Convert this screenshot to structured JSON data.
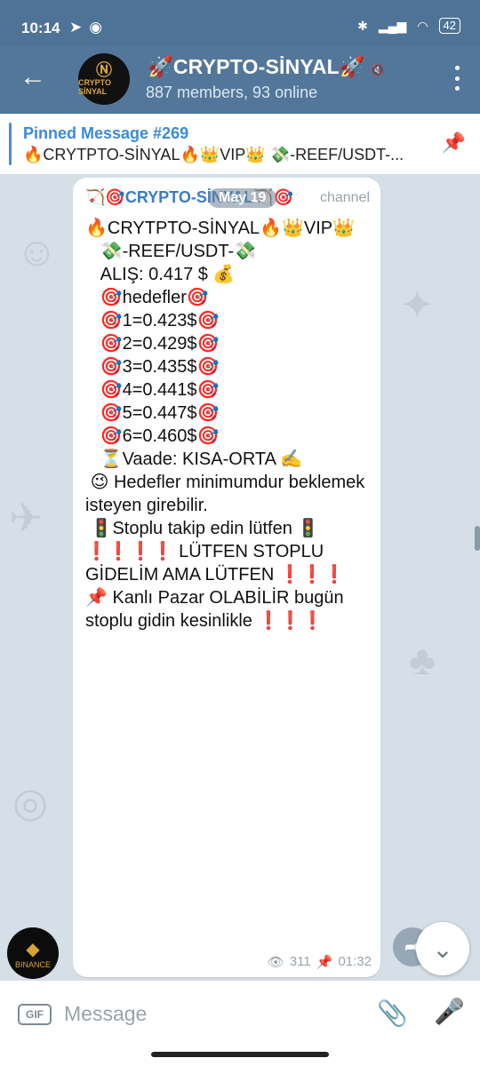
{
  "status": {
    "time": "10:14",
    "battery": "42"
  },
  "header": {
    "title": "🚀CRYPTO-SİNYAL🚀",
    "subtitle": "887 members, 93 online",
    "avatar_text": "CRYPTO SİNYAL"
  },
  "pinned": {
    "title": "Pinned Message #269",
    "text": "🔥CRYTPTO-SİNYAL🔥👑VIP👑    💸-REEF/USDT-..."
  },
  "message": {
    "sender": "🏹🎯CRYPTO-SİNYAL🏹🎯",
    "date_pill": "May 19",
    "channel_label": "channel",
    "lines": [
      "🔥CRYTPTO-SİNYAL🔥👑VIP👑",
      "",
      "   💸-REEF/USDT-💸",
      "",
      "   ALIŞ: 0.417 $ 💰",
      "",
      "   🎯hedefler🎯",
      "",
      "   🎯1=0.423$🎯",
      "",
      "   🎯2=0.429$🎯",
      "",
      "   🎯3=0.435$🎯",
      "",
      "   🎯4=0.441$🎯",
      "",
      "   🎯5=0.447$🎯",
      "",
      "   🎯6=0.460$🎯",
      "",
      "   ⏳Vaade: KISA-ORTA ✍️",
      "",
      " 😉 Hedefler minimumdur beklemek isteyen girebilir.",
      "",
      " 🚦Stoplu takip edin lütfen 🚦",
      "",
      "❗️❗️❗️❗️ LÜTFEN STOPLU GİDELİM AMA LÜTFEN ❗️❗️❗️",
      "",
      "📌 Kanlı Pazar OLABİLİR bugün stoplu gidin kesinlikle ❗️❗️❗️"
    ],
    "views": "311",
    "time": "01:32"
  },
  "input": {
    "placeholder": "Message",
    "gif_label": "GIF"
  },
  "channel_avatar_text": "BINANCE"
}
